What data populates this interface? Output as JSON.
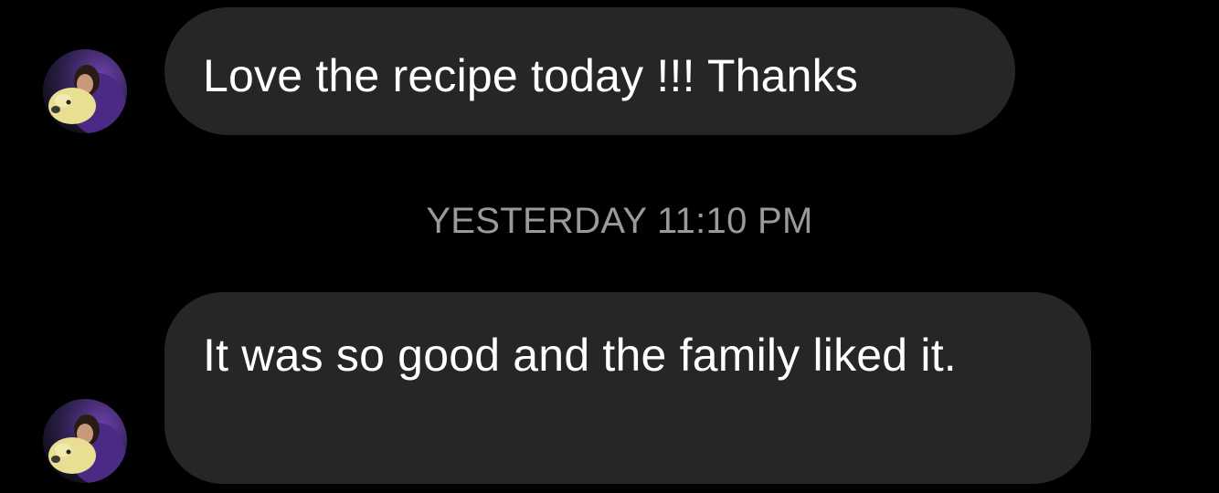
{
  "messages": [
    {
      "text": "Love the recipe today !!! Thanks",
      "avatar": "user-avatar"
    },
    {
      "text": "It was so good and the family liked it.",
      "avatar": "user-avatar"
    }
  ],
  "timestamp": "YESTERDAY 11:10 PM",
  "colors": {
    "background": "#000000",
    "bubble": "#262626",
    "message_text": "#ffffff",
    "timestamp_text": "#9a9a9a"
  }
}
